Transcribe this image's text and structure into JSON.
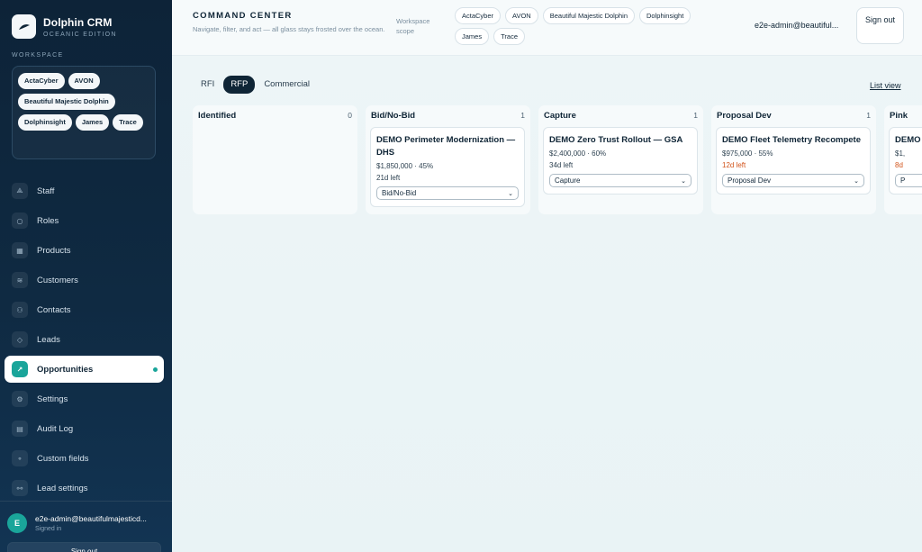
{
  "brand": {
    "name": "Dolphin CRM",
    "subtitle": "OCEANIC EDITION"
  },
  "sidebar": {
    "workspace_label": "WORKSPACE",
    "workspaces": [
      "ActaCyber",
      "AVON",
      "Beautiful Majestic Dolphin",
      "Dolphinsight",
      "James",
      "Trace"
    ],
    "nav": [
      {
        "label": "Staff",
        "icon": "staff-icon",
        "glyph": "⟁"
      },
      {
        "label": "Roles",
        "icon": "roles-icon",
        "glyph": "○"
      },
      {
        "label": "Products",
        "icon": "products-icon",
        "glyph": "▦"
      },
      {
        "label": "Customers",
        "icon": "customers-icon",
        "glyph": "≋"
      },
      {
        "label": "Contacts",
        "icon": "contacts-icon",
        "glyph": "⚇"
      },
      {
        "label": "Leads",
        "icon": "leads-icon",
        "glyph": "◇"
      },
      {
        "label": "Opportunities",
        "icon": "opportunities-icon",
        "glyph": "↗",
        "active": true
      },
      {
        "label": "Settings",
        "icon": "settings-icon",
        "glyph": "⚙"
      },
      {
        "label": "Audit Log",
        "icon": "audit-log-icon",
        "glyph": "▤"
      },
      {
        "label": "Custom fields",
        "icon": "custom-fields-icon",
        "glyph": "⚬"
      },
      {
        "label": "Lead settings",
        "icon": "lead-settings-icon",
        "glyph": "⚯"
      }
    ],
    "user": {
      "initial": "E",
      "email": "e2e-admin@beautifulmajesticd...",
      "status": "Signed in",
      "signout": "Sign out"
    }
  },
  "header": {
    "title": "COMMAND CENTER",
    "subtitle": "Navigate, filter, and act — all glass stays frosted over the ocean.",
    "scope_label": "Workspace scope",
    "scope_chips": [
      "ActaCyber",
      "AVON",
      "Beautiful Majestic Dolphin",
      "Dolphinsight",
      "James",
      "Trace"
    ],
    "user_email": "e2e-admin@beautiful...",
    "signout_label": "Sign out"
  },
  "main": {
    "tabs": [
      {
        "label": "RFI",
        "active": false
      },
      {
        "label": "RFP",
        "active": true
      },
      {
        "label": "Commercial",
        "active": false
      }
    ],
    "list_view_label": "List view",
    "columns": [
      {
        "title": "Identified",
        "count": "0",
        "cards": []
      },
      {
        "title": "Bid/No-Bid",
        "count": "1",
        "cards": [
          {
            "title": "DEMO Perimeter Modernization — DHS",
            "meta": "$1,850,000 · 45%",
            "due": "21d left",
            "urgent": false,
            "stage": "Bid/No-Bid"
          }
        ]
      },
      {
        "title": "Capture",
        "count": "1",
        "cards": [
          {
            "title": "DEMO Zero Trust Rollout — GSA",
            "meta": "$2,400,000 · 60%",
            "due": "34d left",
            "urgent": false,
            "stage": "Capture"
          }
        ]
      },
      {
        "title": "Proposal Dev",
        "count": "1",
        "cards": [
          {
            "title": "DEMO Fleet Telemetry Recompete",
            "meta": "$975,000 · 55%",
            "due": "12d left",
            "urgent": true,
            "stage": "Proposal Dev"
          }
        ]
      },
      {
        "title": "Pink",
        "count": "",
        "cards": [
          {
            "title": "DEMO Se",
            "meta": "$1,",
            "due": "8d",
            "urgent": true,
            "stage": "P"
          }
        ]
      }
    ]
  },
  "colors": {
    "accent": "#1aa59a",
    "sidebar_bg": "#0f2a42",
    "urgent": "#d2541b"
  }
}
